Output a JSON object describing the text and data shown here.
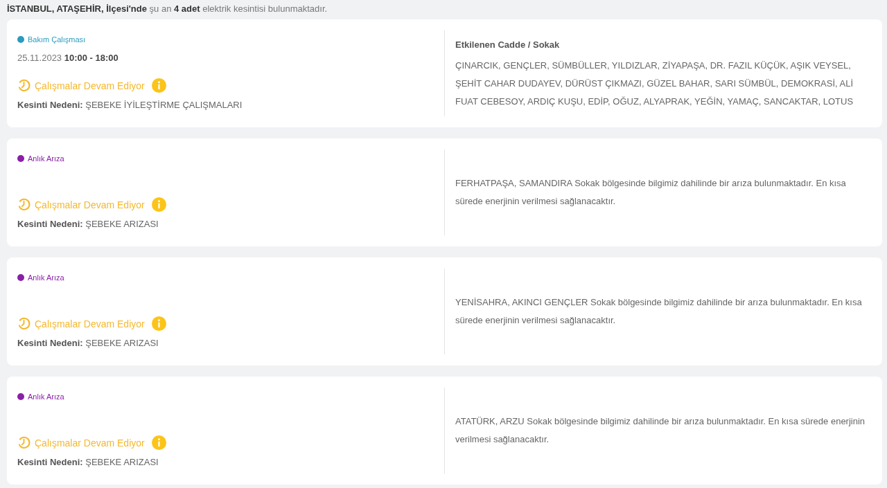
{
  "summary": "**İSTANBUL, ATAŞEHİR, İlçesi'nde** şu an **4 adet** elektrik kesintisi bulunmaktadır.",
  "outages": [
    {
      "type": "Bakım Çalışması",
      "color": "#2a9bbf",
      "date": "25.11.2023 **10:00 - 18:00**",
      "status": "Çalışmalar Devam Ediyor",
      "reason_label": "Kesinti Nedeni:",
      "reason": "ŞEBEKE İYİLEŞTİRME ÇALIŞMALARI",
      "streets_heading": "Etkilenen Cadde / Sokak",
      "streets": "ÇINARCIK, GENÇLER, SÜMBÜLLER, YILDIZLAR, ZİYAPAŞA, DR. FAZIL KÜÇÜK, AŞIK VEYSEL, ŞEHİT CAHAR DUDAYEV, DÜRÜST ÇIKMAZI, GÜZEL BAHAR, SARI SÜMBÜL, DEMOKRASİ, ALİ FUAT CEBESOY, ARDIÇ KUŞU, EDİP, OĞUZ, ALYAPRAK, YEĞİN, YAMAÇ, SANCAKTAR, LOTUS"
    },
    {
      "type": "Anlık Arıza",
      "color": "#8a1fa8",
      "status": "Çalışmalar Devam Ediyor",
      "reason_label": "Kesinti Nedeni:",
      "reason": "ŞEBEKE ARIZASI",
      "streets": "FERHATPAŞA, SAMANDIRA Sokak bölgesinde bilgimiz dahilinde bir arıza bulunmaktadır. En kısa sürede enerjinin verilmesi sağlanacaktır."
    },
    {
      "type": "Anlık Arıza",
      "color": "#8a1fa8",
      "status": "Çalışmalar Devam Ediyor",
      "reason_label": "Kesinti Nedeni:",
      "reason": "ŞEBEKE ARIZASI",
      "streets": "YENİSAHRA, AKINCI GENÇLER Sokak bölgesinde bilgimiz dahilinde bir arıza bulunmaktadır. En kısa sürede enerjinin verilmesi sağlanacaktır."
    },
    {
      "type": "Anlık Arıza",
      "color": "#8a1fa8",
      "status": "Çalışmalar Devam Ediyor",
      "reason_label": "Kesinti Nedeni:",
      "reason": "ŞEBEKE ARIZASI",
      "streets": "ATATÜRK, ARZU Sokak bölgesinde bilgimiz dahilinde bir arıza bulunmaktadır. En kısa sürede enerjinin verilmesi sağlanacaktır."
    }
  ]
}
